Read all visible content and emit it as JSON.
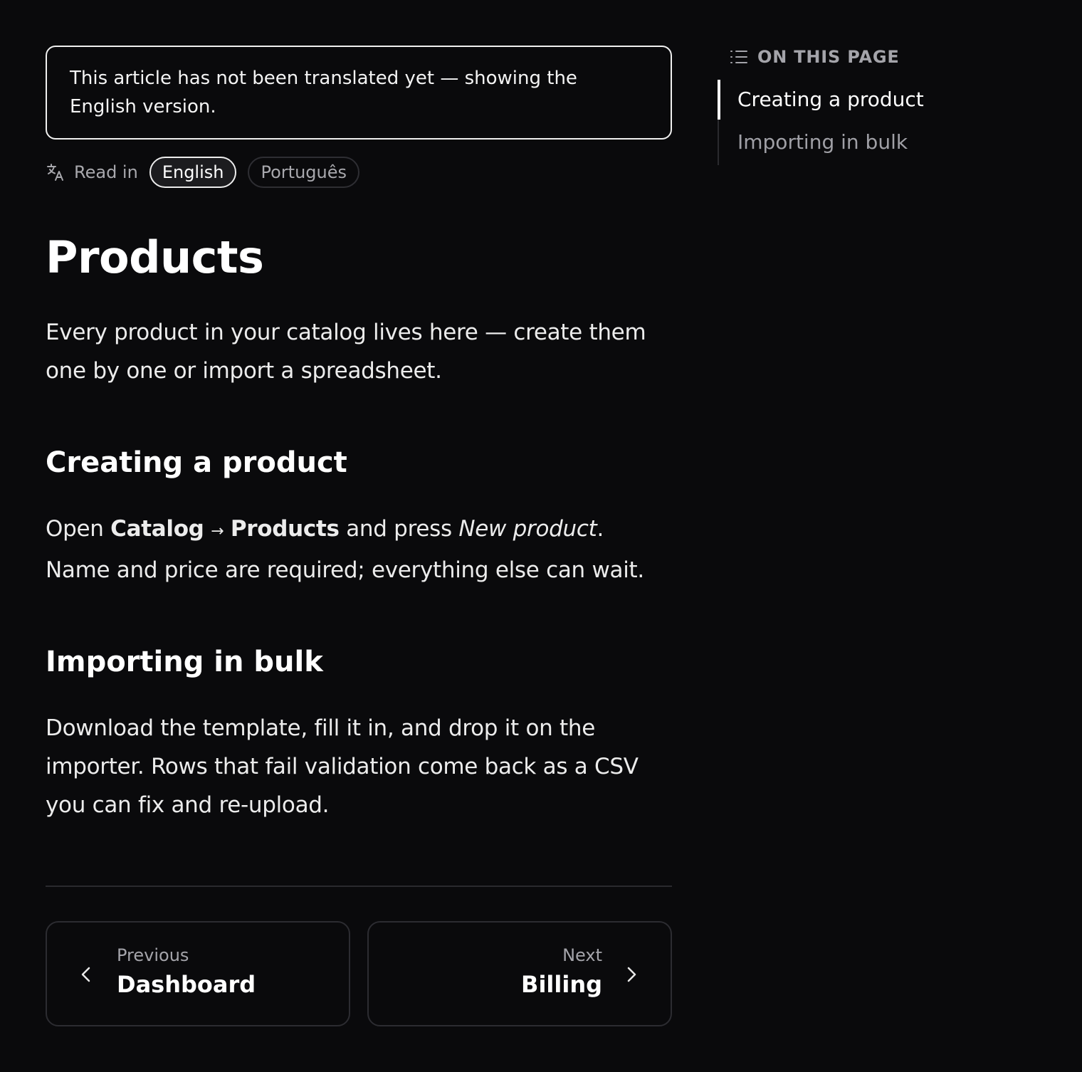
{
  "notice": {
    "text": "This article has not been translated yet — showing the English version."
  },
  "language": {
    "read_in": "Read in",
    "options": [
      {
        "label": "English",
        "selected": true
      },
      {
        "label": "Português",
        "selected": false
      }
    ]
  },
  "article": {
    "title": "Products",
    "lead": "Every product in your catalog lives here — create them one by one or import a spreadsheet.",
    "sections": [
      {
        "heading": "Creating a product",
        "body_parts": {
          "p1": "Open ",
          "b1": "Catalog",
          "arrow": "→",
          "b2": "Products",
          "p2": " and press ",
          "i1": "New product",
          "p3": ". Name and price are required; everything else can wait."
        }
      },
      {
        "heading": "Importing in bulk",
        "body": "Download the template, fill it in, and drop it on the importer. Rows that fail validation come back as a CSV you can fix and re-upload."
      }
    ]
  },
  "pagination": {
    "previous": {
      "label": "Previous",
      "title": "Dashboard"
    },
    "next": {
      "label": "Next",
      "title": "Billing"
    }
  },
  "toc": {
    "heading": "ON THIS PAGE",
    "items": [
      {
        "label": "Creating a product",
        "active": true
      },
      {
        "label": "Importing in bulk",
        "active": false
      }
    ]
  },
  "colors": {
    "background": "#0a0a0c",
    "text": "#f2f2f2",
    "muted": "#a4a4aa",
    "border": "#2c2c31"
  },
  "icons": {
    "language": "translate-icon",
    "toc": "list-icon",
    "previous": "chevron-left-icon",
    "next": "chevron-right-icon"
  }
}
